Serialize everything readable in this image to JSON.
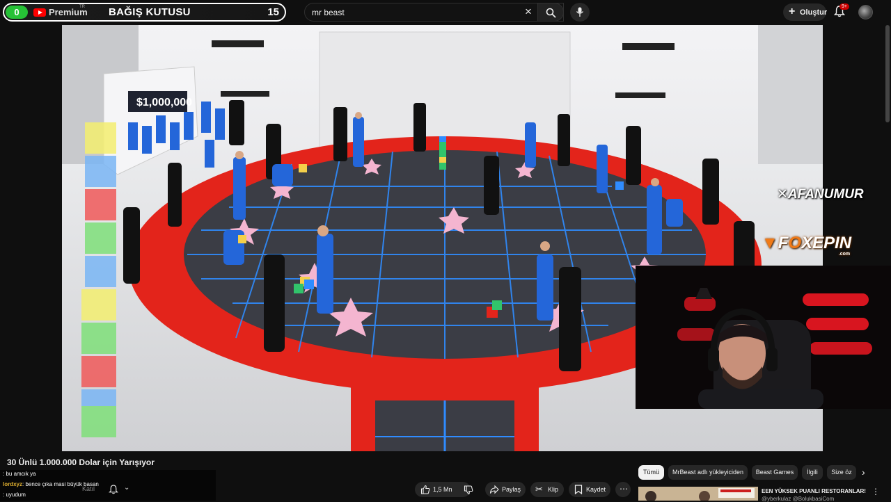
{
  "donation_box": {
    "count": "0",
    "brand": "Premium",
    "brand_tm": "TR",
    "title": "BAĞIŞ KUTUSU",
    "amount": "15"
  },
  "search": {
    "query": "mr beast"
  },
  "header": {
    "create_label": "Oluştur",
    "notification_badge": "9+"
  },
  "video": {
    "prize_sign": "$1,000,000",
    "overlay_brand_1": "AFANUMUR",
    "overlay_brand_2_a": "F",
    "overlay_brand_2_b": "O",
    "overlay_brand_2_c": "XEPIN",
    "overlay_brand_2_suffix": ".com",
    "title": "30 Ünlü 1.000.000 Dolar için Yarışıyor"
  },
  "chat": [
    {
      "user": "",
      "message": ": bu amcık ya",
      "color": "#f1f1f1"
    },
    {
      "user": "lordxyz",
      "message": ": bence çıka masi büyük basan",
      "color": "#e0b030"
    },
    {
      "user": "",
      "message": ": uyudum",
      "color": "#5fa8ff"
    }
  ],
  "actions": {
    "likes": "1,5 Mn",
    "share": "Paylaş",
    "clip": "Klip",
    "save": "Kaydet",
    "join_ghost": "Katıl"
  },
  "chips": [
    "Tümü",
    "MrBeast adlı yükleyiciden",
    "Beast Games",
    "İlgili",
    "Size öz"
  ],
  "recommendation": {
    "title": "EEN YÜKSEK PUANLI RESTORANLAR!",
    "channel": "@yberkulaz @BolukbasiCom"
  },
  "colors": {
    "accent": "#ff0000",
    "donation_green": "#26c136",
    "arena_red": "#e3241b",
    "grid_blue": "#2f8cff"
  }
}
